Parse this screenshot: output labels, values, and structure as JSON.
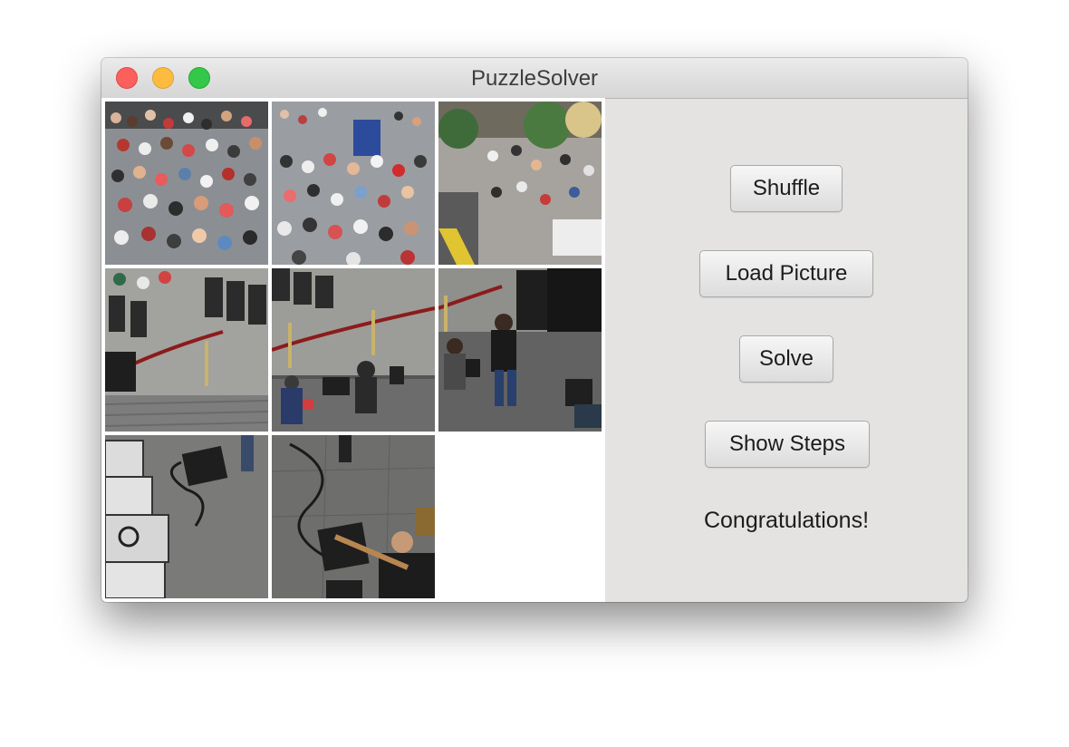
{
  "window": {
    "title": "PuzzleSolver"
  },
  "puzzle": {
    "grid_size": 3,
    "tiles": [
      {
        "row": 0,
        "col": 0,
        "content": "crowd seated, top-left of photo"
      },
      {
        "row": 0,
        "col": 1,
        "content": "crowd seated, top-center of photo"
      },
      {
        "row": 0,
        "col": 2,
        "content": "standing audience and palm trees"
      },
      {
        "row": 1,
        "col": 0,
        "content": "front row chairs and rope barrier"
      },
      {
        "row": 1,
        "col": 1,
        "content": "band on stage with keyboard"
      },
      {
        "row": 1,
        "col": 2,
        "content": "trumpet player and speakers"
      },
      {
        "row": 2,
        "col": 0,
        "content": "road cases and stage monitor"
      },
      {
        "row": 2,
        "col": 1,
        "content": "guitarist on stage"
      },
      {
        "row": 2,
        "col": 2,
        "content": "empty"
      }
    ]
  },
  "controls": {
    "shuffle_label": "Shuffle",
    "load_picture_label": "Load Picture",
    "solve_label": "Solve",
    "show_steps_label": "Show Steps",
    "status_text": "Congratulations!"
  },
  "colors": {
    "window_background": "#e4e3e1",
    "close": "#fc605c",
    "minimize": "#fdbc40",
    "zoom": "#34c84a"
  }
}
